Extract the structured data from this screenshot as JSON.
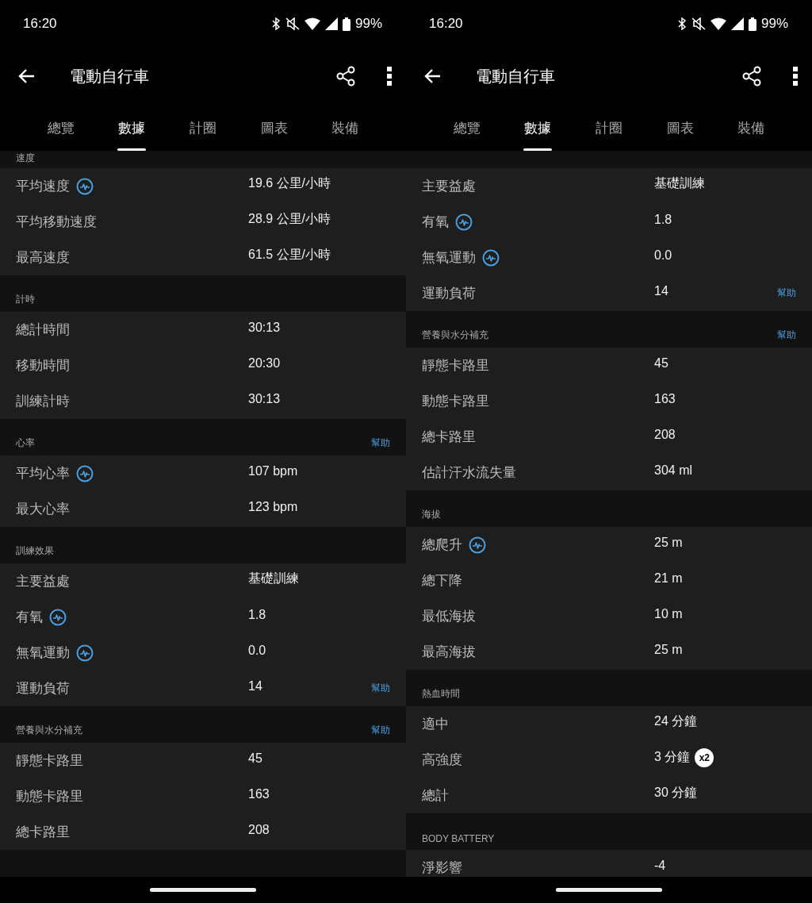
{
  "phones": [
    {
      "status": {
        "time": "16:20",
        "battery": "99%"
      },
      "title": "電動自行車",
      "tabs": [
        {
          "label": "總覽",
          "selected": false
        },
        {
          "label": "數據",
          "selected": true
        },
        {
          "label": "計圈",
          "selected": false
        },
        {
          "label": "圖表",
          "selected": false
        },
        {
          "label": "裝備",
          "selected": false
        }
      ],
      "sections": [
        {
          "title": "速度",
          "rows": [
            {
              "label": "平均速度",
              "info": true,
              "value": "19.6 公里/小時"
            },
            {
              "label": "平均移動速度",
              "info": false,
              "value": "28.9 公里/小時"
            },
            {
              "label": "最高速度",
              "info": false,
              "value": "61.5 公里/小時"
            }
          ]
        },
        {
          "title": "計時",
          "rows": [
            {
              "label": "總計時間",
              "info": false,
              "value": "30:13"
            },
            {
              "label": "移動時間",
              "info": false,
              "value": "20:30"
            },
            {
              "label": "訓練計時",
              "info": false,
              "value": "30:13"
            }
          ]
        },
        {
          "title": "心率",
          "help": "幫助",
          "rows": [
            {
              "label": "平均心率",
              "info": true,
              "value": "107 bpm"
            },
            {
              "label": "最大心率",
              "info": false,
              "value": "123 bpm"
            }
          ]
        },
        {
          "title": "訓練效果",
          "rows": [
            {
              "label": "主要益處",
              "info": false,
              "value": "基礎訓練"
            },
            {
              "label": "有氧",
              "info": true,
              "value": "1.8"
            },
            {
              "label": "無氧運動",
              "info": true,
              "value": "0.0"
            },
            {
              "label": "運動負荷",
              "info": false,
              "value": "14",
              "help": "幫助"
            }
          ]
        },
        {
          "title": "營養與水分補充",
          "help": "幫助",
          "rows": [
            {
              "label": "靜態卡路里",
              "info": false,
              "value": "45"
            },
            {
              "label": "動態卡路里",
              "info": false,
              "value": "163"
            },
            {
              "label": "總卡路里",
              "info": false,
              "value": "208"
            }
          ]
        }
      ]
    },
    {
      "status": {
        "time": "16:20",
        "battery": "99%"
      },
      "title": "電動自行車",
      "tabs": [
        {
          "label": "總覽",
          "selected": false
        },
        {
          "label": "數據",
          "selected": true
        },
        {
          "label": "計圈",
          "selected": false
        },
        {
          "label": "圖表",
          "selected": false
        },
        {
          "label": "裝備",
          "selected": false
        }
      ],
      "sections": [
        {
          "rows": [
            {
              "label": "主要益處",
              "info": false,
              "value": "基礎訓練"
            },
            {
              "label": "有氧",
              "info": true,
              "value": "1.8"
            },
            {
              "label": "無氧運動",
              "info": true,
              "value": "0.0"
            },
            {
              "label": "運動負荷",
              "info": false,
              "value": "14",
              "help": "幫助"
            }
          ]
        },
        {
          "title": "營養與水分補充",
          "help": "幫助",
          "rows": [
            {
              "label": "靜態卡路里",
              "info": false,
              "value": "45"
            },
            {
              "label": "動態卡路里",
              "info": false,
              "value": "163"
            },
            {
              "label": "總卡路里",
              "info": false,
              "value": "208"
            },
            {
              "label": "估計汗水流失量",
              "info": false,
              "value": "304 ml"
            }
          ]
        },
        {
          "title": "海拔",
          "rows": [
            {
              "label": "總爬升",
              "info": true,
              "value": "25 m"
            },
            {
              "label": "總下降",
              "info": false,
              "value": "21 m"
            },
            {
              "label": "最低海拔",
              "info": false,
              "value": "10 m"
            },
            {
              "label": "最高海拔",
              "info": false,
              "value": "25 m"
            }
          ]
        },
        {
          "title": "熱血時間",
          "rows": [
            {
              "label": "適中",
              "info": false,
              "value": "24 分鐘"
            },
            {
              "label": "高強度",
              "info": false,
              "value": "3 分鐘",
              "badge": "x2"
            },
            {
              "label": "總計",
              "info": false,
              "value": "30 分鐘"
            }
          ]
        },
        {
          "title": "BODY BATTERY",
          "rows": [
            {
              "label": "淨影響",
              "info": false,
              "value": "-4"
            }
          ]
        }
      ]
    }
  ]
}
